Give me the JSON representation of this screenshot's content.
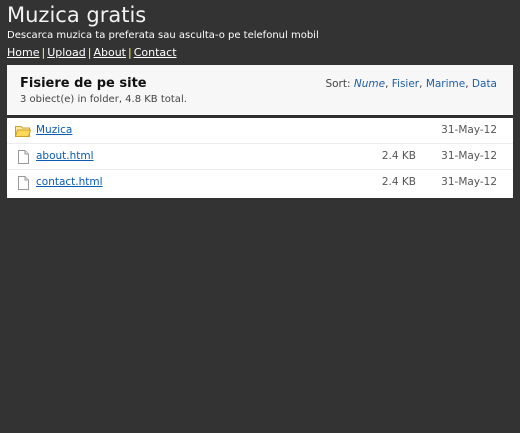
{
  "header": {
    "title": "Muzica gratis",
    "tagline": "Descarca muzica ta preferata sau asculta-o pe telefonul mobil"
  },
  "nav": {
    "items": [
      {
        "label": "Home"
      },
      {
        "label": "Upload"
      },
      {
        "label": "About"
      },
      {
        "label": "Contact"
      }
    ],
    "separator": "|"
  },
  "panel": {
    "title": "Fisiere de pe site",
    "summary": "3 obiect(e) in folder, 4.8 KB total.",
    "sort": {
      "label": "Sort:",
      "options": [
        "Nume",
        "Fisier",
        "Marime",
        "Data"
      ],
      "active": "Nume"
    }
  },
  "files": [
    {
      "name": "Muzica",
      "size": "",
      "date": "31-May-12",
      "icon": "folder-icon"
    },
    {
      "name": "about.html",
      "size": "2.4 KB",
      "date": "31-May-12",
      "icon": "file-icon"
    },
    {
      "name": "contact.html",
      "size": "2.4 KB",
      "date": "31-May-12",
      "icon": "file-icon"
    }
  ],
  "colors": {
    "background": "#333333",
    "link": "#0b5bb5",
    "nav_separator": "#ffff66"
  }
}
